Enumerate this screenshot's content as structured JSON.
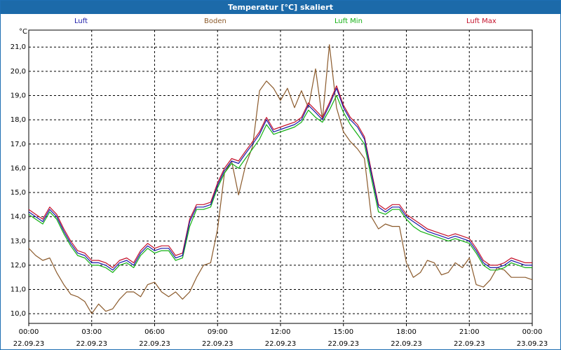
{
  "window": {
    "title": "Temperatur [°C] skaliert"
  },
  "colors": {
    "title_bar": "#1c6aa9",
    "luft": "#1a1aa8",
    "boden": "#8b5a2b",
    "luft_min": "#12b012",
    "luft_max": "#c4102a"
  },
  "chart_data": {
    "type": "line",
    "title": "Temperatur [°C] skaliert",
    "ylabel": "°C",
    "ylim": [
      9.6,
      21.7
    ],
    "yticks": [
      "10,0",
      "11,0",
      "12,0",
      "13,0",
      "14,0",
      "15,0",
      "16,0",
      "17,0",
      "18,0",
      "19,0",
      "20,0",
      "21,0"
    ],
    "xlim": [
      0,
      24
    ],
    "xticks": [
      {
        "time": "00:00",
        "date": "22.09.23"
      },
      {
        "time": "03:00",
        "date": "22.09.23"
      },
      {
        "time": "06:00",
        "date": "22.09.23"
      },
      {
        "time": "09:00",
        "date": "22.09.23"
      },
      {
        "time": "12:00",
        "date": "22.09.23"
      },
      {
        "time": "15:00",
        "date": "22.09.23"
      },
      {
        "time": "18:00",
        "date": "22.09.23"
      },
      {
        "time": "21:00",
        "date": "22.09.23"
      },
      {
        "time": "00:00",
        "date": "23.09.23"
      }
    ],
    "grid": true,
    "legend_position": "top",
    "series": [
      {
        "name": "Luft",
        "x": [
          0,
          0.33,
          0.67,
          1,
          1.33,
          1.67,
          2,
          2.33,
          2.67,
          3,
          3.33,
          3.67,
          4,
          4.33,
          4.67,
          5,
          5.33,
          5.67,
          6,
          6.33,
          6.67,
          7,
          7.33,
          7.67,
          8,
          8.33,
          8.67,
          9,
          9.33,
          9.67,
          10,
          10.33,
          10.67,
          11,
          11.33,
          11.67,
          12,
          12.33,
          12.67,
          13,
          13.33,
          13.67,
          14,
          14.33,
          14.67,
          15,
          15.33,
          15.67,
          16,
          16.33,
          16.67,
          17,
          17.33,
          17.67,
          18,
          18.33,
          18.67,
          19,
          19.33,
          19.67,
          20,
          20.33,
          20.67,
          21,
          21.33,
          21.67,
          22,
          22.33,
          22.67,
          23,
          23.33,
          23.67,
          24
        ],
        "y": [
          14.2,
          14.0,
          13.8,
          14.3,
          14.0,
          13.4,
          12.9,
          12.5,
          12.4,
          12.1,
          12.1,
          12.0,
          11.8,
          12.1,
          12.2,
          12.0,
          12.5,
          12.8,
          12.6,
          12.7,
          12.7,
          12.3,
          12.4,
          13.8,
          14.4,
          14.4,
          14.5,
          15.3,
          15.9,
          16.3,
          16.2,
          16.6,
          17.0,
          17.4,
          18.0,
          17.5,
          17.6,
          17.7,
          17.8,
          18.0,
          18.6,
          18.3,
          18.0,
          18.6,
          19.3,
          18.5,
          18.0,
          17.7,
          17.2,
          15.8,
          14.4,
          14.2,
          14.4,
          14.4,
          14.0,
          13.8,
          13.6,
          13.4,
          13.3,
          13.2,
          13.1,
          13.2,
          13.1,
          13.0,
          12.6,
          12.1,
          11.9,
          11.9,
          12.0,
          12.2,
          12.1,
          12.0,
          12.0
        ]
      },
      {
        "name": "Boden",
        "x": [
          0,
          0.33,
          0.67,
          1,
          1.33,
          1.67,
          2,
          2.33,
          2.67,
          3,
          3.33,
          3.67,
          4,
          4.33,
          4.67,
          5,
          5.33,
          5.67,
          6,
          6.33,
          6.67,
          7,
          7.33,
          7.67,
          8,
          8.33,
          8.67,
          9,
          9.33,
          9.67,
          10,
          10.33,
          10.67,
          11,
          11.33,
          11.67,
          12,
          12.33,
          12.67,
          13,
          13.33,
          13.67,
          14,
          14.33,
          14.67,
          15,
          15.33,
          15.67,
          16,
          16.33,
          16.67,
          17,
          17.33,
          17.67,
          18,
          18.33,
          18.67,
          19,
          19.33,
          19.67,
          20,
          20.33,
          20.67,
          21,
          21.33,
          21.67,
          22,
          22.33,
          22.67,
          23,
          23.33,
          23.67,
          24
        ],
        "y": [
          12.7,
          12.4,
          12.2,
          12.3,
          11.7,
          11.2,
          10.8,
          10.7,
          10.5,
          10.0,
          10.4,
          10.1,
          10.2,
          10.6,
          10.9,
          10.9,
          10.7,
          11.2,
          11.3,
          10.9,
          10.7,
          10.9,
          10.6,
          10.9,
          11.5,
          12.0,
          12.1,
          13.5,
          15.8,
          16.3,
          14.9,
          16.1,
          16.9,
          19.2,
          19.6,
          19.3,
          18.8,
          19.3,
          18.5,
          19.2,
          18.5,
          20.1,
          18.0,
          21.1,
          18.5,
          17.5,
          17.1,
          16.8,
          16.4,
          14.0,
          13.5,
          13.7,
          13.6,
          13.6,
          12.1,
          11.5,
          11.7,
          12.2,
          12.1,
          11.6,
          11.7,
          12.1,
          11.9,
          12.3,
          11.2,
          11.1,
          11.4,
          11.9,
          11.8,
          11.5,
          11.5,
          11.5,
          11.4
        ]
      },
      {
        "name": "Luft Min",
        "x": [
          0,
          0.33,
          0.67,
          1,
          1.33,
          1.67,
          2,
          2.33,
          2.67,
          3,
          3.33,
          3.67,
          4,
          4.33,
          4.67,
          5,
          5.33,
          5.67,
          6,
          6.33,
          6.67,
          7,
          7.33,
          7.67,
          8,
          8.33,
          8.67,
          9,
          9.33,
          9.67,
          10,
          10.33,
          10.67,
          11,
          11.33,
          11.67,
          12,
          12.33,
          12.67,
          13,
          13.33,
          13.67,
          14,
          14.33,
          14.67,
          15,
          15.33,
          15.67,
          16,
          16.33,
          16.67,
          17,
          17.33,
          17.67,
          18,
          18.33,
          18.67,
          19,
          19.33,
          19.67,
          20,
          20.33,
          20.67,
          21,
          21.33,
          21.67,
          22,
          22.33,
          22.67,
          23,
          23.33,
          23.67,
          24
        ],
        "y": [
          14.1,
          13.9,
          13.7,
          14.2,
          13.9,
          13.3,
          12.8,
          12.4,
          12.3,
          12.0,
          12.0,
          11.9,
          11.7,
          12.0,
          12.1,
          11.9,
          12.4,
          12.7,
          12.5,
          12.6,
          12.6,
          12.2,
          12.3,
          13.6,
          14.3,
          14.3,
          14.4,
          15.2,
          15.8,
          16.2,
          16.0,
          16.4,
          16.8,
          17.2,
          17.8,
          17.4,
          17.5,
          17.6,
          17.7,
          17.9,
          18.4,
          18.1,
          17.9,
          18.4,
          19.0,
          18.3,
          17.8,
          17.4,
          17.0,
          15.6,
          14.2,
          14.1,
          14.3,
          14.3,
          13.9,
          13.6,
          13.4,
          13.3,
          13.2,
          13.1,
          13.0,
          13.1,
          13.0,
          12.9,
          12.5,
          12.0,
          11.8,
          11.8,
          11.9,
          12.1,
          12.0,
          11.9,
          11.9
        ]
      },
      {
        "name": "Luft Max",
        "x": [
          0,
          0.33,
          0.67,
          1,
          1.33,
          1.67,
          2,
          2.33,
          2.67,
          3,
          3.33,
          3.67,
          4,
          4.33,
          4.67,
          5,
          5.33,
          5.67,
          6,
          6.33,
          6.67,
          7,
          7.33,
          7.67,
          8,
          8.33,
          8.67,
          9,
          9.33,
          9.67,
          10,
          10.33,
          10.67,
          11,
          11.33,
          11.67,
          12,
          12.33,
          12.67,
          13,
          13.33,
          13.67,
          14,
          14.33,
          14.67,
          15,
          15.33,
          15.67,
          16,
          16.33,
          16.67,
          17,
          17.33,
          17.67,
          18,
          18.33,
          18.67,
          19,
          19.33,
          19.67,
          20,
          20.33,
          20.67,
          21,
          21.33,
          21.67,
          22,
          22.33,
          22.67,
          23,
          23.33,
          23.67,
          24
        ],
        "y": [
          14.3,
          14.1,
          13.9,
          14.4,
          14.1,
          13.5,
          13.0,
          12.6,
          12.5,
          12.2,
          12.2,
          12.1,
          11.9,
          12.2,
          12.3,
          12.1,
          12.6,
          12.9,
          12.7,
          12.8,
          12.8,
          12.4,
          12.5,
          13.9,
          14.5,
          14.5,
          14.6,
          15.4,
          16.0,
          16.4,
          16.3,
          16.7,
          17.1,
          17.5,
          18.1,
          17.6,
          17.7,
          17.8,
          17.9,
          18.1,
          18.7,
          18.4,
          18.1,
          18.7,
          19.4,
          18.6,
          18.1,
          17.8,
          17.3,
          15.9,
          14.5,
          14.3,
          14.5,
          14.5,
          14.1,
          13.9,
          13.7,
          13.5,
          13.4,
          13.3,
          13.2,
          13.3,
          13.2,
          13.1,
          12.7,
          12.2,
          12.0,
          12.0,
          12.1,
          12.3,
          12.2,
          12.1,
          12.1
        ]
      }
    ]
  }
}
